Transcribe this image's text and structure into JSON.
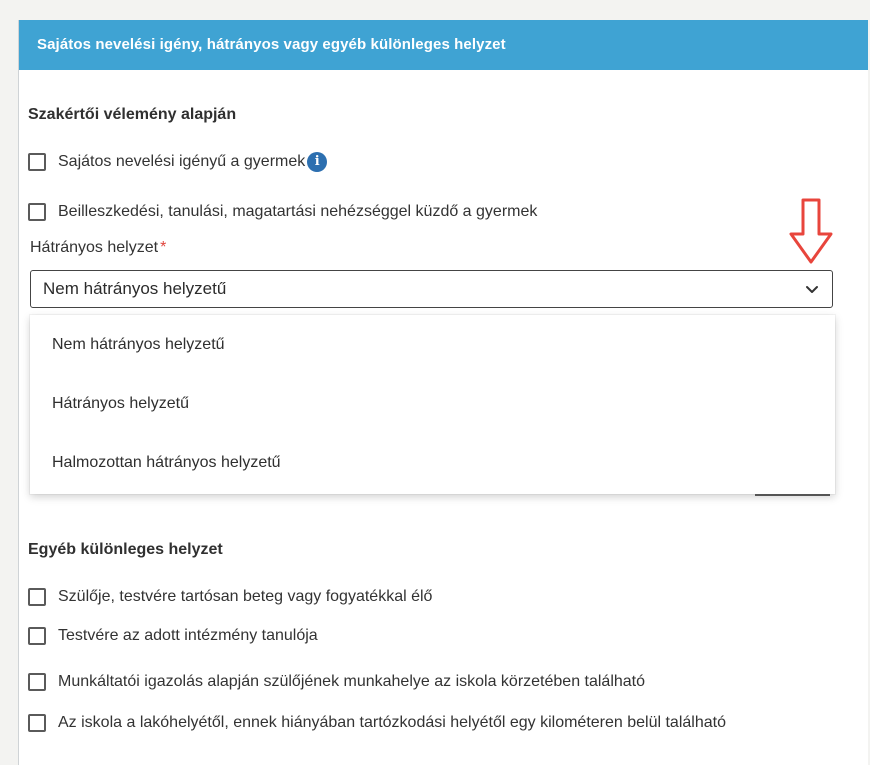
{
  "header": {
    "title": "Sajátos nevelési igény, hátrányos vagy egyéb különleges helyzet"
  },
  "expert": {
    "title": "Szakértői vélemény alapján",
    "options": [
      "Sajátos nevelési igényű a gyermek",
      "Beilleszkedési, tanulási, magatartási nehézséggel küzdő a gyermek"
    ]
  },
  "disadvantage": {
    "label": "Hátrányos helyzet",
    "required_mark": "*",
    "selected": "Nem hátrányos helyzetű",
    "options": [
      "Nem hátrányos helyzetű",
      "Hátrányos helyzetű",
      "Halmozottan hátrányos helyzetű"
    ]
  },
  "other": {
    "title": "Egyéb különleges helyzet",
    "options": [
      "Szülője, testvére tartósan beteg vagy fogyatékkal élő",
      "Testvére az adott intézmény tanulója",
      "Munkáltatói igazolás alapján szülőjének munkahelye az iskola körzetében található",
      "Az iskola a lakóhelyétől, ennek hiányában tartózkodási helyétől egy kilométeren belül található"
    ]
  },
  "colors": {
    "header_bg": "#3fa3d3",
    "info_icon": "#2c6fb0",
    "required": "#e0443c",
    "annotation_arrow": "#e8453c"
  },
  "icons": {
    "info": "info-icon",
    "select_arrow": "chevron-down-icon",
    "annotation": "annotation-arrow-icon"
  }
}
